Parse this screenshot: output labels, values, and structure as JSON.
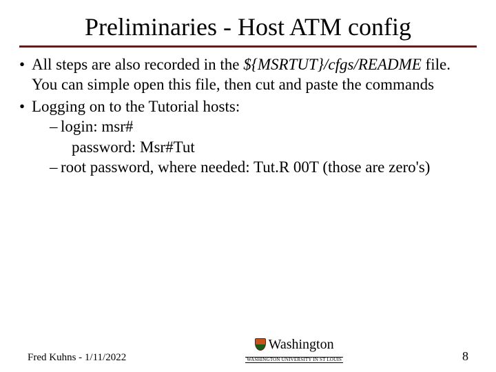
{
  "title": "Preliminaries - Host ATM config",
  "b1a": "All steps are also recorded in the ",
  "b1b": "${MSRTUT}/cfgs/README",
  "b1c": " file. You can simple open this file, then cut and paste the commands",
  "b2": "Logging on to the Tutorial hosts:",
  "s1a": "login: msr#",
  "s1b": "password: Msr#Tut",
  "s2": "root password, where needed: Tut.R 00T (those are zero's)",
  "footer": {
    "author_date": "Fred Kuhns - 1/11/2022",
    "university": "Washington",
    "subline": "WASHINGTON UNIVERSITY IN ST LOUIS",
    "page": "8"
  }
}
